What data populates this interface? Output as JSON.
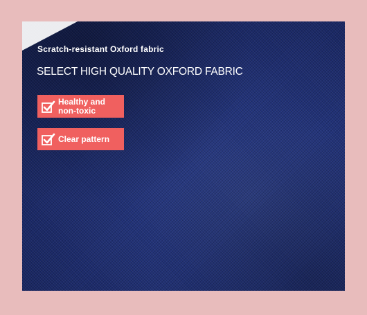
{
  "banner": {
    "subtitle": "Scratch-resistant Oxford fabric",
    "headline": "SELECT HIGH QUALITY OXFORD FABRIC",
    "badges": [
      {
        "label": "Healthy and\nnon-toxic",
        "icon": "checkbox-checked-icon"
      },
      {
        "label": "Clear pattern",
        "icon": "checkbox-checked-icon"
      }
    ]
  },
  "colors": {
    "background_pink": "#e8bcbc",
    "fabric_navy": "#1b2a66",
    "badge_coral": "#f0605f",
    "text_white": "#ffffff"
  }
}
